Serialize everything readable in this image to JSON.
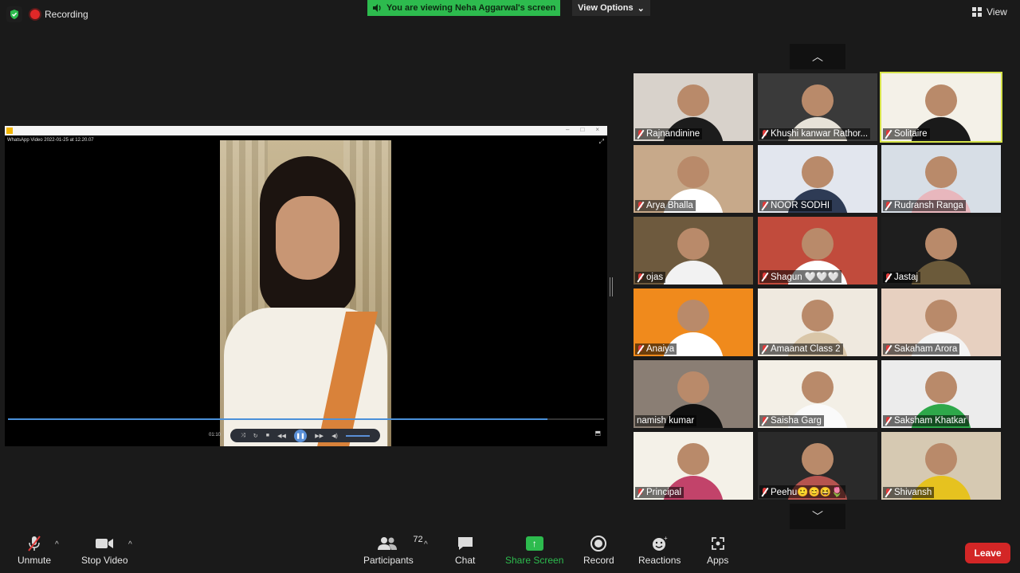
{
  "topbar": {
    "recording_label": "Recording",
    "banner_text": "You are viewing Neha Aggarwal's screen",
    "view_options_label": "View Options",
    "view_label": "View"
  },
  "shared_video": {
    "title": "WhatsApp Video 2022-01-25 at 12.20.07",
    "time": "01:10",
    "progress_fraction": 0.905
  },
  "participants": [
    {
      "name": "Rajnandinine",
      "muted": true,
      "bg": "#d8d2cb",
      "torso": "#1c1c1c"
    },
    {
      "name": "Khushi kanwar Rathor...",
      "muted": true,
      "bg": "#3a3a3a",
      "torso": "#e7e2d8"
    },
    {
      "name": "Solitaire",
      "muted": true,
      "bg": "#f4f1e8",
      "torso": "#1a1a1a",
      "active": true
    },
    {
      "name": "Arya Bhalla",
      "muted": true,
      "bg": "#c7a98a",
      "torso": "#ffffff"
    },
    {
      "name": "NOOR SODHI",
      "muted": true,
      "bg": "#e2e6ee",
      "torso": "#2e3b55"
    },
    {
      "name": "Rudransh Ranga",
      "muted": true,
      "bg": "#d7dee6",
      "torso": "#e8b7bd"
    },
    {
      "name": "ojas",
      "muted": true,
      "bg": "#6e5a3e",
      "torso": "#f2f2f2"
    },
    {
      "name": "Shagun 🤍🤍🤍",
      "muted": true,
      "bg": "#c14b3c",
      "torso": "#ffffff"
    },
    {
      "name": "Jastaj",
      "muted": true,
      "bg": "#1e1e1e",
      "torso": "#6b5a3a"
    },
    {
      "name": "Anaiya",
      "muted": true,
      "bg": "#f08a1c",
      "torso": "#ffffff"
    },
    {
      "name": "Amaanat  Class  2",
      "muted": true,
      "bg": "#efe9df",
      "torso": "#d9c6a8"
    },
    {
      "name": "Sakaham Arora",
      "muted": true,
      "bg": "#e7d0c0",
      "torso": "#f4f4f4"
    },
    {
      "name": "namish kumar",
      "muted": false,
      "bg": "#8a7e74",
      "torso": "#101010"
    },
    {
      "name": "Saisha Garg",
      "muted": true,
      "bg": "#f3efe6",
      "torso": "#fafafa"
    },
    {
      "name": "Saksham Khatkar",
      "muted": true,
      "bg": "#ececec",
      "torso": "#2ea84a"
    },
    {
      "name": "Principal",
      "muted": true,
      "bg": "#f4f1e8",
      "torso": "#c2436a"
    },
    {
      "name": "Peehu🙂😊😆🌷",
      "muted": true,
      "bg": "#2a2a2a",
      "torso": "#b5544f"
    },
    {
      "name": "Shivansh",
      "muted": true,
      "bg": "#d6c9b2",
      "torso": "#e6c21f"
    }
  ],
  "toolbar": {
    "unmute": "Unmute",
    "stop_video": "Stop Video",
    "participants": "Participants",
    "participants_count": "72",
    "chat": "Chat",
    "share_screen": "Share Screen",
    "record": "Record",
    "reactions": "Reactions",
    "apps": "Apps",
    "leave": "Leave"
  },
  "colors": {
    "accent_green": "#2dbb4e",
    "leave_red": "#d32626",
    "active_speaker": "#d6e34a"
  },
  "icons": {
    "security": "shield-check-icon",
    "recording": "record-dot-icon",
    "screen_audio": "speaker-icon",
    "view": "grid-icon",
    "gallery_prev": "chevron-up-icon",
    "gallery_next": "chevron-down-icon"
  }
}
